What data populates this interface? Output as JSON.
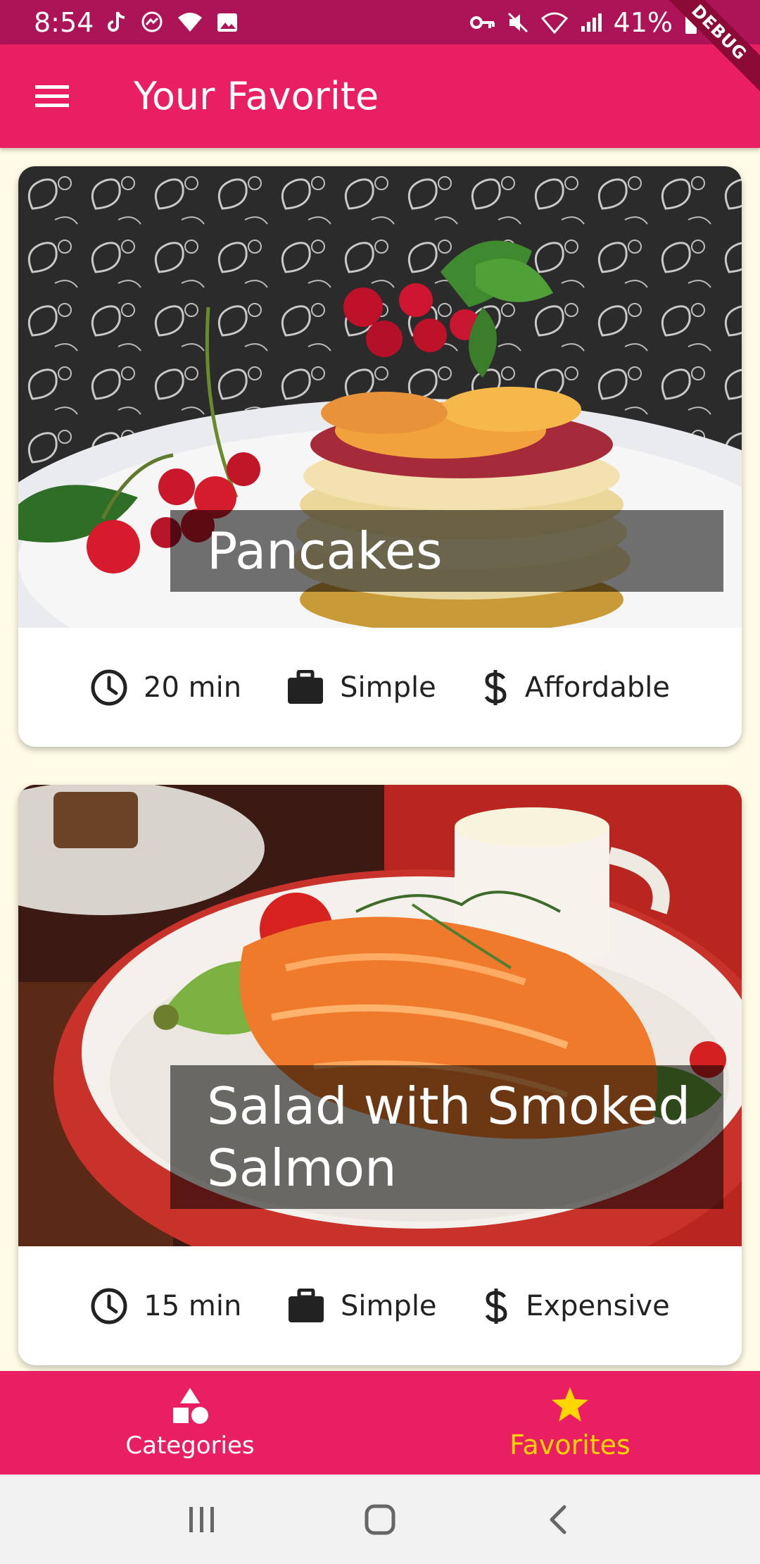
{
  "status_bar": {
    "time": "8:54",
    "battery": "41%",
    "left_icons": [
      "tiktok-icon",
      "messenger-icon",
      "wifi-icon",
      "gallery-icon"
    ],
    "right_icons": [
      "key-icon",
      "mute-icon",
      "wifi-call-icon",
      "signal-icon",
      "battery-icon"
    ]
  },
  "debug_banner": "DEBUG",
  "app_bar": {
    "title": "Your Favorite",
    "menu_icon": "menu-icon"
  },
  "meals": [
    {
      "title": "Pancakes",
      "duration": "20 min",
      "complexity": "Simple",
      "affordability": "Affordable"
    },
    {
      "title": "Salad with Smoked Salmon",
      "duration": "15 min",
      "complexity": "Simple",
      "affordability": "Expensive"
    }
  ],
  "bottom_nav": {
    "items": [
      {
        "label": "Categories",
        "icon": "category-icon",
        "active": false
      },
      {
        "label": "Favorites",
        "icon": "star-icon",
        "active": true
      }
    ]
  },
  "colors": {
    "primary": "#E91E63",
    "status_bar": "#AD1457",
    "background": "#FFFBE6",
    "active_nav": "#FFD600"
  }
}
